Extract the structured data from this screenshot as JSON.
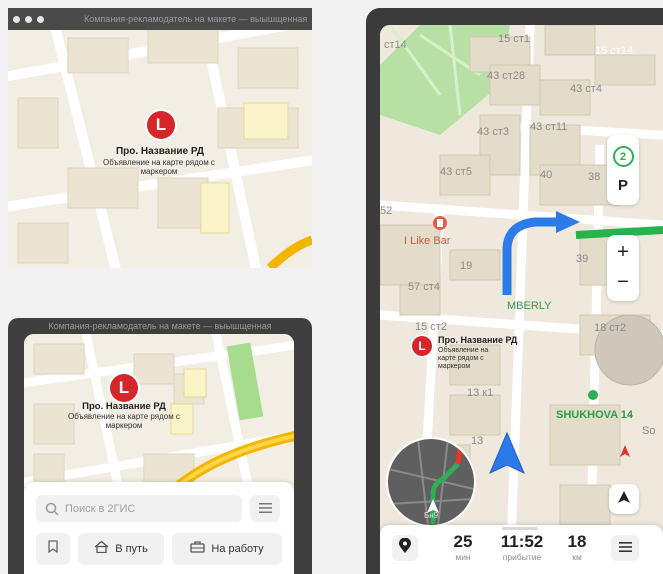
{
  "top_left": {
    "window_title": "Компания-рекламодатель на макете — выышщенная",
    "marker_letter": "L",
    "poi_title": "Про. Название РД",
    "poi_subtitle": "Объявление на карте рядом с маркером"
  },
  "bottom_left": {
    "window_title": "Компания-рекламодатель на макете — выышщенная",
    "marker_letter": "L",
    "poi_title": "Про. Название РД",
    "poi_subtitle": "Объявление на карте рядом с маркером",
    "search_placeholder": "Поиск в 2ГИС",
    "bookmark_icon": "bookmark-icon",
    "route_home_label": "В путь",
    "route_work_label": "На работу"
  },
  "navigator": {
    "labels": {
      "l1": "15 ст1",
      "l2": "15 ст14",
      "l3": "43 ст28",
      "l4": "43 ст4",
      "l5": "43 ст3",
      "l6": "43 ст11",
      "l7": "43 ст5",
      "l8": "40",
      "l9": "38",
      "l10": "19",
      "l11": "39",
      "l12": "57 ст4",
      "l13": "15 ст2",
      "l14": "18 ст2",
      "l15": "13 к1",
      "l16": "13",
      "l17": "ст14",
      "l18": "52",
      "l19": "So"
    },
    "bar_label": "I Like Bar",
    "mberly_label": "MBERLY",
    "shukhova_label": "SHUKHOVA 14",
    "marker_letter": "L",
    "poi_title": "Про. Название РД",
    "poi_subtitle": "Объявление на карте рядом с маркером",
    "traffic_level": "2",
    "parking_label": "P",
    "zoom_in_label": "+",
    "zoom_out_label": "−",
    "minimap_label": "Бн9",
    "eta": {
      "duration_value": "25",
      "duration_unit": "мин",
      "arrival_value": "11:52",
      "arrival_unit": "прибытие",
      "distance_value": "18",
      "distance_unit": "км"
    }
  }
}
